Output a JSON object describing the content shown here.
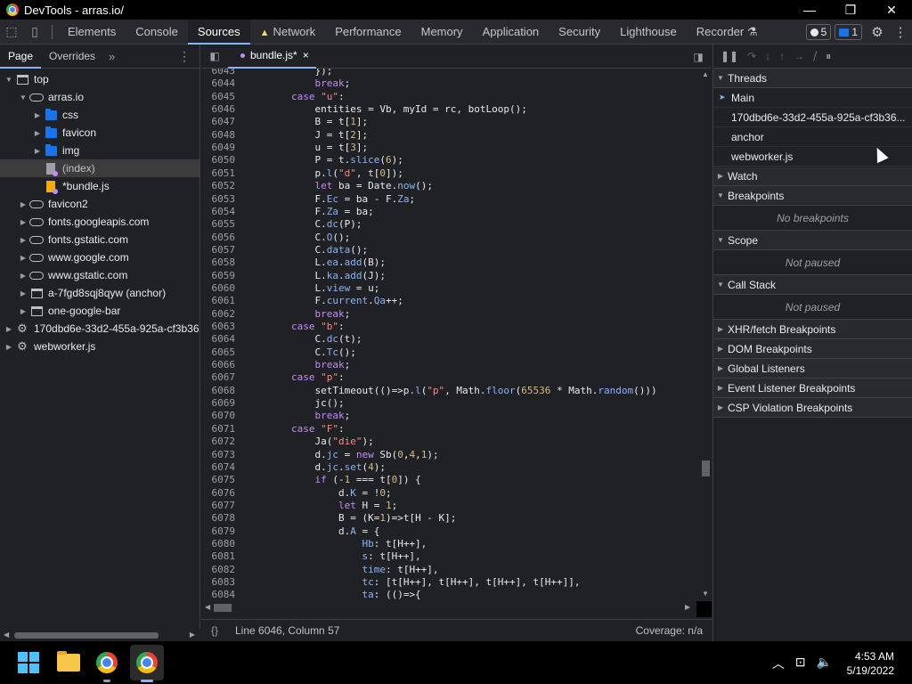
{
  "window": {
    "title": "DevTools - arras.io/",
    "controls": [
      "—",
      "❐",
      "✕"
    ]
  },
  "tabs": [
    {
      "label": "Elements"
    },
    {
      "label": "Console"
    },
    {
      "label": "Sources",
      "active": true
    },
    {
      "label": "Network",
      "warning": true
    },
    {
      "label": "Performance"
    },
    {
      "label": "Memory"
    },
    {
      "label": "Application"
    },
    {
      "label": "Security"
    },
    {
      "label": "Lighthouse"
    },
    {
      "label": "Recorder"
    }
  ],
  "badges": {
    "issues": "5",
    "messages": "1"
  },
  "navigator": {
    "tabs": [
      "Page",
      "Overrides"
    ],
    "tree": [
      {
        "label": "top",
        "icon": "frame-icon",
        "level": 0,
        "arrow": "▼"
      },
      {
        "label": "arras.io",
        "icon": "cloud-icon",
        "level": 1,
        "arrow": "▼"
      },
      {
        "label": "css",
        "icon": "folder-icon",
        "level": 2,
        "arrow": "▶"
      },
      {
        "label": "favicon",
        "icon": "folder-icon",
        "level": 2,
        "arrow": "▶"
      },
      {
        "label": "img",
        "icon": "folder-icon",
        "level": 2,
        "arrow": "▶"
      },
      {
        "label": "(index)",
        "icon": "file-icon",
        "level": 2,
        "arrow": "",
        "selected": true
      },
      {
        "label": "*bundle.js",
        "icon": "js-file-icon",
        "level": 2,
        "arrow": ""
      },
      {
        "label": "favicon2",
        "icon": "cloud-icon",
        "level": 1,
        "arrow": "▶"
      },
      {
        "label": "fonts.googleapis.com",
        "icon": "cloud-icon",
        "level": 1,
        "arrow": "▶"
      },
      {
        "label": "fonts.gstatic.com",
        "icon": "cloud-icon",
        "level": 1,
        "arrow": "▶"
      },
      {
        "label": "www.google.com",
        "icon": "cloud-icon",
        "level": 1,
        "arrow": "▶"
      },
      {
        "label": "www.gstatic.com",
        "icon": "cloud-icon",
        "level": 1,
        "arrow": "▶"
      },
      {
        "label": "a-7fgd8sqj8qyw (anchor)",
        "icon": "frame-icon",
        "level": 1,
        "arrow": "▶"
      },
      {
        "label": "one-google-bar",
        "icon": "frame-icon",
        "level": 1,
        "arrow": "▶"
      },
      {
        "label": "170dbd6e-33d2-455a-925a-cf3b36",
        "icon": "gear-icon",
        "level": 0,
        "arrow": "▶"
      },
      {
        "label": "webworker.js",
        "icon": "gear-icon",
        "level": 0,
        "arrow": "▶"
      }
    ]
  },
  "editor": {
    "file_tab": "bundle.js*",
    "close": "×",
    "status_position": "Line 6046, Column 57",
    "coverage": "Coverage: n/a",
    "braces": "{}",
    "lines": [
      {
        "n": "6043",
        "html": "            });"
      },
      {
        "n": "6044",
        "html": "            <span class=\"kw\">break</span>;"
      },
      {
        "n": "6045",
        "html": "        <span class=\"kw\">case</span> <span class=\"st\">\"u\"</span>:"
      },
      {
        "n": "6046",
        "html": "            entities = Vb, myId = rc, botLoop();"
      },
      {
        "n": "6047",
        "html": "            B = t[<span class=\"nm\">1</span>];"
      },
      {
        "n": "6048",
        "html": "            J = t[<span class=\"nm\">2</span>];"
      },
      {
        "n": "6049",
        "html": "            u = t[<span class=\"nm\">3</span>];"
      },
      {
        "n": "6050",
        "html": "            P = t.<span class=\"pr\">slice</span>(<span class=\"nm\">6</span>);"
      },
      {
        "n": "6051",
        "html": "            p.<span class=\"pr\">l</span>(<span class=\"st\">\"d\"</span>, t[<span class=\"nm\">0</span>]);"
      },
      {
        "n": "6052",
        "html": "            <span class=\"kw\">let</span> ba = Date.<span class=\"pr\">now</span>();"
      },
      {
        "n": "6053",
        "html": "            F.<span class=\"pr\">Ec</span> = ba - F.<span class=\"pr\">Za</span>;"
      },
      {
        "n": "6054",
        "html": "            F.<span class=\"pr\">Za</span> = ba;"
      },
      {
        "n": "6055",
        "html": "            C.<span class=\"pr\">dc</span>(P);"
      },
      {
        "n": "6056",
        "html": "            C.<span class=\"pr\">O</span>();"
      },
      {
        "n": "6057",
        "html": "            C.<span class=\"pr\">data</span>();"
      },
      {
        "n": "6058",
        "html": "            L.<span class=\"pr\">ea</span>.<span class=\"pr\">add</span>(B);"
      },
      {
        "n": "6059",
        "html": "            L.<span class=\"pr\">ka</span>.<span class=\"pr\">add</span>(J);"
      },
      {
        "n": "6060",
        "html": "            L.<span class=\"pr\">view</span> = u;"
      },
      {
        "n": "6061",
        "html": "            F.<span class=\"pr\">current</span>.<span class=\"pr\">Qa</span>++;"
      },
      {
        "n": "6062",
        "html": "            <span class=\"kw\">break</span>;"
      },
      {
        "n": "6063",
        "html": "        <span class=\"kw\">case</span> <span class=\"st\">\"b\"</span>:"
      },
      {
        "n": "6064",
        "html": "            C.<span class=\"pr\">dc</span>(t);"
      },
      {
        "n": "6065",
        "html": "            C.<span class=\"pr\">Tc</span>();"
      },
      {
        "n": "6066",
        "html": "            <span class=\"kw\">break</span>;"
      },
      {
        "n": "6067",
        "html": "        <span class=\"kw\">case</span> <span class=\"st\">\"p\"</span>:"
      },
      {
        "n": "6068",
        "html": "            setTimeout(()=>p.<span class=\"pr\">l</span>(<span class=\"st\">\"p\"</span>, Math.<span class=\"pr\">floor</span>(<span class=\"nm\">65536</span> * Math.<span class=\"pr\">random</span>()))"
      },
      {
        "n": "6069",
        "html": "            jc();"
      },
      {
        "n": "6070",
        "html": "            <span class=\"kw\">break</span>;"
      },
      {
        "n": "6071",
        "html": "        <span class=\"kw\">case</span> <span class=\"st\">\"F\"</span>:"
      },
      {
        "n": "6072",
        "html": "            Ja(<span class=\"st\">\"die\"</span>);"
      },
      {
        "n": "6073",
        "html": "            d.<span class=\"pr\">jc</span> = <span class=\"kw\">new</span> Sb(<span class=\"nm\">0</span>,<span class=\"nm\">4</span>,<span class=\"nm\">1</span>);"
      },
      {
        "n": "6074",
        "html": "            d.<span class=\"pr\">jc</span>.<span class=\"pr\">set</span>(<span class=\"nm\">4</span>);"
      },
      {
        "n": "6075",
        "html": "            <span class=\"kw\">if</span> (-<span class=\"nm\">1</span> === t[<span class=\"nm\">0</span>]) {"
      },
      {
        "n": "6076",
        "html": "                d.<span class=\"pr\">K</span> = !<span class=\"nm\">0</span>;"
      },
      {
        "n": "6077",
        "html": "                <span class=\"kw\">let</span> H = <span class=\"nm\">1</span>;"
      },
      {
        "n": "6078",
        "html": "                B = (K=<span class=\"nm\">1</span>)=>t[H - K];"
      },
      {
        "n": "6079",
        "html": "                d.<span class=\"pr\">A</span> = {"
      },
      {
        "n": "6080",
        "html": "                    <span class=\"pr\">Hb</span>: t[H++],"
      },
      {
        "n": "6081",
        "html": "                    <span class=\"pr\">s</span>: t[H++],"
      },
      {
        "n": "6082",
        "html": "                    <span class=\"pr\">time</span>: t[H++],"
      },
      {
        "n": "6083",
        "html": "                    <span class=\"pr\">tc</span>: [t[H++], t[H++], t[H++], t[H++]],"
      },
      {
        "n": "6084",
        "html": "                    <span class=\"pr\">ta</span>: (()=>{"
      }
    ]
  },
  "debugger": {
    "sections": {
      "threads": "Threads",
      "watch": "Watch",
      "breakpoints": "Breakpoints",
      "no_breakpoints": "No breakpoints",
      "scope": "Scope",
      "scope_state": "Not paused",
      "callstack": "Call Stack",
      "callstack_state": "Not paused",
      "xhr": "XHR/fetch Breakpoints",
      "dom": "DOM Breakpoints",
      "global": "Global Listeners",
      "event": "Event Listener Breakpoints",
      "csp": "CSP Violation Breakpoints"
    },
    "threads": [
      "Main",
      "170dbd6e-33d2-455a-925a-cf3b36...",
      "anchor",
      "webworker.js"
    ]
  },
  "taskbar": {
    "time": "4:53 AM",
    "date": "5/19/2022"
  }
}
